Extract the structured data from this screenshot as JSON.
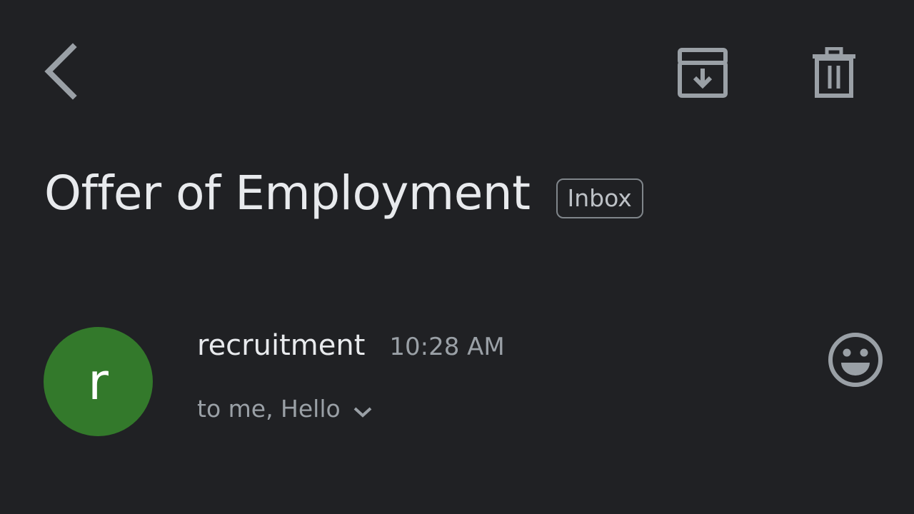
{
  "toolbar": {
    "back_icon": "chevron-left-icon",
    "archive_icon": "archive-icon",
    "delete_icon": "trash-icon",
    "icon_color": "#9aa0a6"
  },
  "email": {
    "subject": "Offer of Employment",
    "label": "Inbox",
    "sender": {
      "name": "recruitment",
      "avatar_initial": "r",
      "avatar_color": "#33792b"
    },
    "time": "10:28 AM",
    "recipients": "to me, Hello",
    "expand_icon": "chevron-down-icon",
    "react_icon": "smiley-face-icon"
  },
  "theme": {
    "background": "#202124",
    "text_primary": "#e8eaed",
    "text_secondary": "#9aa0a6"
  }
}
